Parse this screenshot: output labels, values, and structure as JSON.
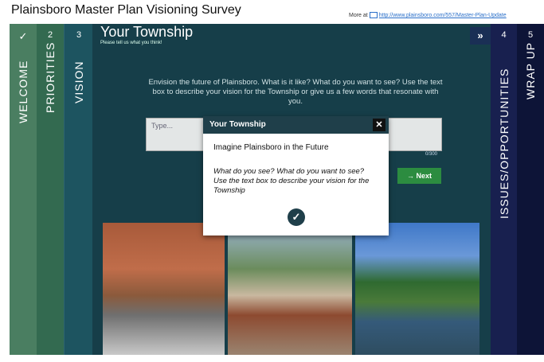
{
  "page_title": "Plainsboro Master Plan Visioning Survey",
  "more_link": {
    "prefix": "More at",
    "url": "http://www.plainsboro.com/557/Master-Plan-Update"
  },
  "steps": [
    {
      "number": "✓",
      "label": "WELCOME"
    },
    {
      "number": "2",
      "label": "PRIORITIES"
    },
    {
      "number": "3",
      "label": "VISION"
    },
    {
      "number": "4",
      "label": "ISSUES/OPPORTUNITIES"
    },
    {
      "number": "5",
      "label": "WRAP UP"
    }
  ],
  "main": {
    "title": "Your Township",
    "subtitle": "Please tell us what you think!",
    "forward_button": "»",
    "prompt": "Envision the future of Plainsboro. What is it like? What do you want to see? Use the text box to describe your vision for the Township or give us a few words that resonate with you.",
    "textbox_placeholder": "Type...",
    "char_counter": "0/300",
    "next_button": "→ Next"
  },
  "dialog": {
    "title": "Your Township",
    "close": "✕",
    "line1": "Imagine Plainsboro in the Future",
    "line2": "What do you see? What do you want to see? Use the text box to describe your vision for the Township",
    "ok": "✓"
  },
  "share_icon": "share-icon",
  "colors": {
    "stage_bg": "#103c46",
    "next_green": "#2c8c40",
    "dialog_header": "#1f3f4a"
  }
}
